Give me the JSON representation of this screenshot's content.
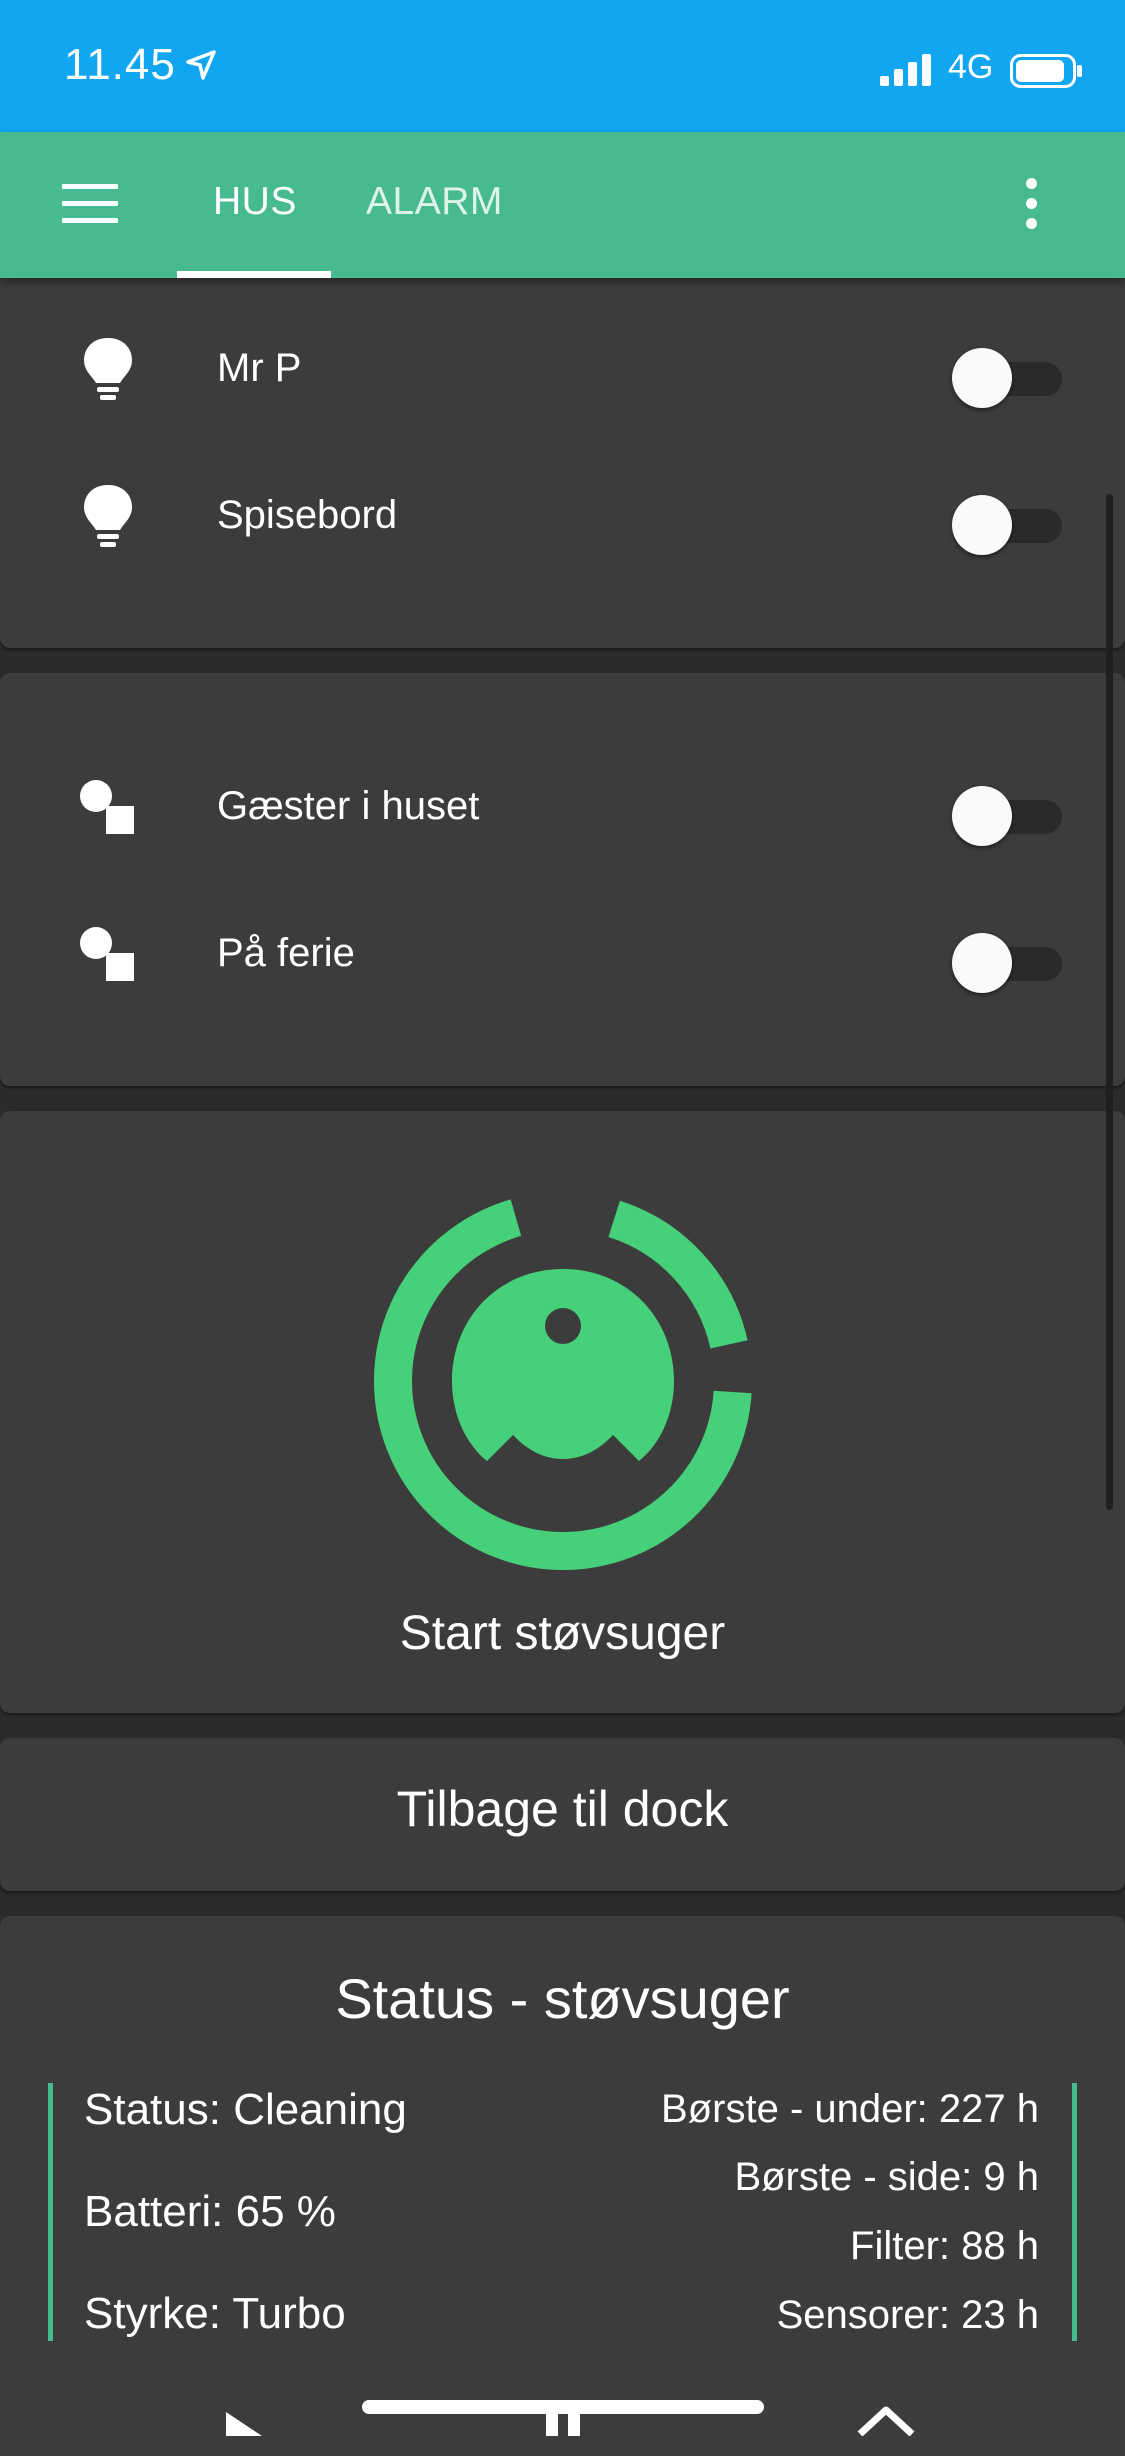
{
  "status_bar": {
    "time": "11.45",
    "network": "4G",
    "icons": [
      "location-arrow-icon",
      "signal-bars-icon",
      "battery-icon"
    ]
  },
  "app_bar": {
    "menu_icon": "hamburger-menu-icon",
    "tabs": [
      {
        "label": "HUS",
        "active": true
      },
      {
        "label": "ALARM",
        "active": false
      }
    ],
    "overflow_icon": "kebab-menu-icon"
  },
  "lights_card": {
    "items": [
      {
        "label": "Mr P",
        "icon": "lightbulb-icon",
        "on": false
      },
      {
        "label": "Spisebord",
        "icon": "lightbulb-icon",
        "on": false
      }
    ]
  },
  "booleans_card": {
    "items": [
      {
        "label": "Gæster i huset",
        "icon": "shapes-icon",
        "on": false
      },
      {
        "label": "På ferie",
        "icon": "shapes-icon",
        "on": false
      }
    ]
  },
  "vacuum_card": {
    "icon": "robot-vacuum-icon",
    "label": "Start støvsuger",
    "accent_color": "#47d07a"
  },
  "dock_card": {
    "label": "Tilbage til dock"
  },
  "status_card": {
    "title": "Status - støvsuger",
    "left": [
      "Status: Cleaning",
      "Batteri: 65 %",
      "Styrke: Turbo"
    ],
    "right": [
      "Børste - under: 227 h",
      "Børste - side: 9 h",
      "Filter: 88 h",
      "Sensorer: 23 h"
    ],
    "accent_color": "#47ba8f",
    "bottom_icons": [
      "play-icon",
      "pause-icon",
      "home-icon"
    ]
  },
  "colors": {
    "status_bar": "#12a5f0",
    "app_bar": "#47ba8f",
    "card": "#3c3c3c",
    "background": "#2b2b2b"
  }
}
